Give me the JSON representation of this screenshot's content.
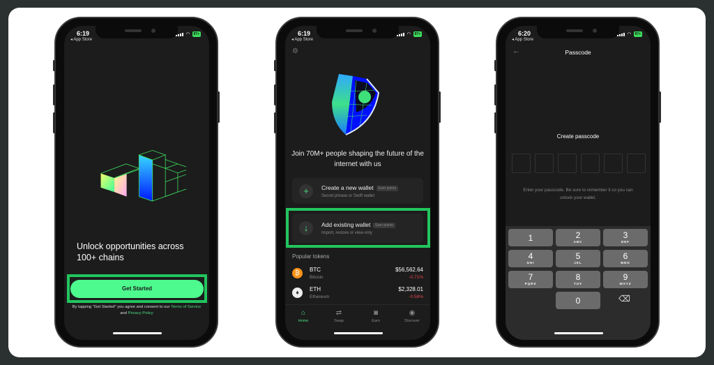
{
  "accent_color": "#4ade80",
  "highlight_color": "#22c55e",
  "phone1": {
    "status": {
      "time": "6:19",
      "back_app": "◂ App Store",
      "battery": "97+"
    },
    "headline": "Unlock opportunities across 100+ chains",
    "get_started": "Get Started",
    "disclaimer_prefix": "By tapping \"Get Started\" you agree and consent to our",
    "terms": "Terms of Service",
    "and": "and",
    "privacy": "Privacy Policy"
  },
  "phone2": {
    "status": {
      "time": "6:19",
      "back_app": "◂ App Store",
      "battery": "97+"
    },
    "settings_icon": "gear-icon",
    "headline": "Join 70M+ people shaping the future of the internet with us",
    "create": {
      "title": "Create a new wallet",
      "badge": "Earn points",
      "subtitle": "Secret phrase or Swift wallet"
    },
    "add": {
      "title": "Add existing wallet",
      "badge": "Earn points",
      "subtitle": "Import, restore or view-only"
    },
    "popular_label": "Popular tokens",
    "tokens": [
      {
        "symbol": "BTC",
        "name": "Bitcoin",
        "price": "$56,562.64",
        "change": "-0.71%"
      },
      {
        "symbol": "ETH",
        "name": "Ethereum",
        "price": "$2,328.01",
        "change": "-0.58%"
      }
    ],
    "tabs": [
      {
        "label": "Home",
        "icon": "home-icon"
      },
      {
        "label": "Swap",
        "icon": "swap-icon"
      },
      {
        "label": "Earn",
        "icon": "earn-icon"
      },
      {
        "label": "Discover",
        "icon": "discover-icon"
      }
    ]
  },
  "phone3": {
    "status": {
      "time": "6:20",
      "back_app": "◂ App Store",
      "battery": "97+"
    },
    "title": "Passcode",
    "prompt": "Create passcode",
    "hint": "Enter your passcode. Be sure to remember it so you can unlock your wallet.",
    "keys": [
      {
        "n": "1",
        "l": ""
      },
      {
        "n": "2",
        "l": "ABC"
      },
      {
        "n": "3",
        "l": "DEF"
      },
      {
        "n": "4",
        "l": "GHI"
      },
      {
        "n": "5",
        "l": "JKL"
      },
      {
        "n": "6",
        "l": "MNO"
      },
      {
        "n": "7",
        "l": "PQRS"
      },
      {
        "n": "8",
        "l": "TUV"
      },
      {
        "n": "9",
        "l": "WXYZ"
      },
      {
        "n": "0",
        "l": ""
      }
    ]
  }
}
